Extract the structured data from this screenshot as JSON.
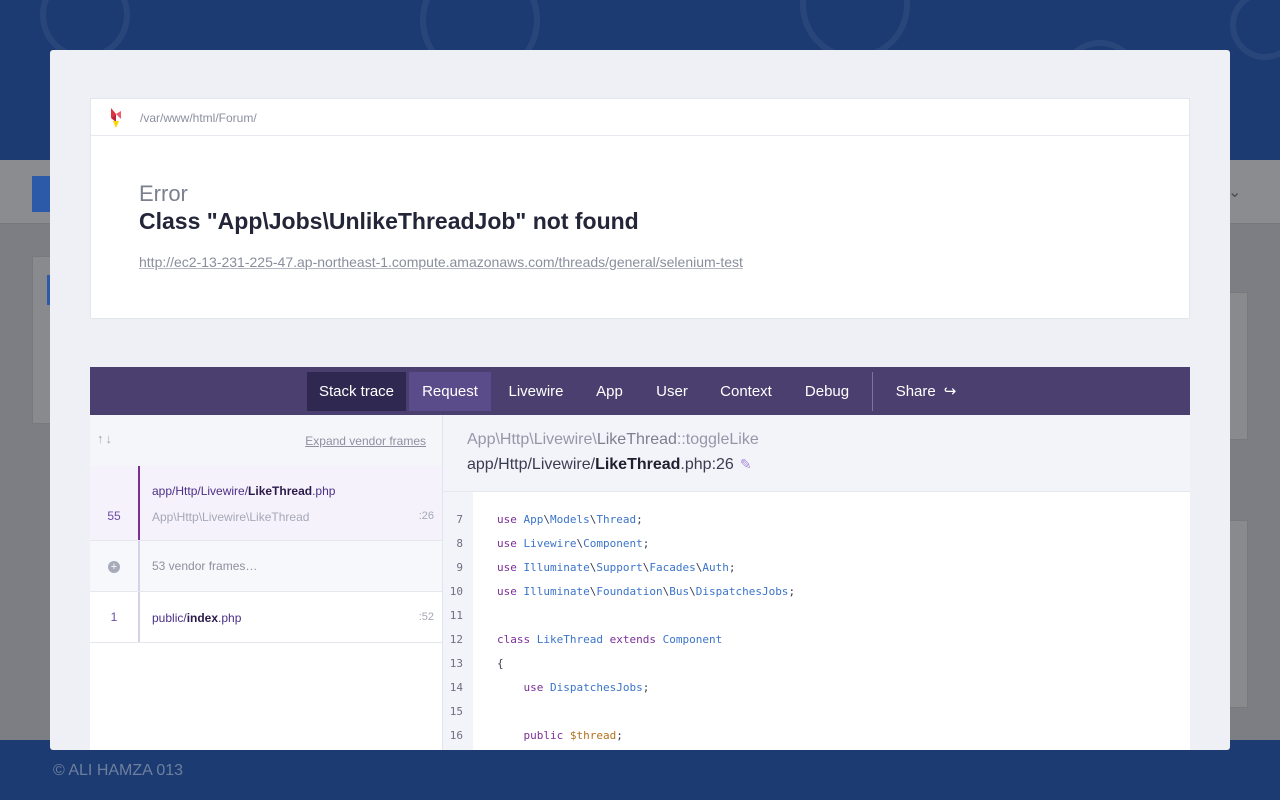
{
  "background": {
    "footer_copyright": "© ALI HAMZA 013"
  },
  "header": {
    "path": "/var/www/html/Forum/",
    "error_label": "Error",
    "error_message": "Class \"App\\Jobs\\UnlikeThreadJob\" not found",
    "url": "http://ec2-13-231-225-47.ap-northeast-1.compute.amazonaws.com/threads/general/selenium-test"
  },
  "tabs": [
    {
      "label": "Stack trace"
    },
    {
      "label": "Request"
    },
    {
      "label": "Livewire"
    },
    {
      "label": "App"
    },
    {
      "label": "User"
    },
    {
      "label": "Context"
    },
    {
      "label": "Debug"
    },
    {
      "label": "Share"
    }
  ],
  "frames": {
    "expand_label": "Expand vendor frames",
    "items": [
      {
        "number": "55",
        "file_prefix": "app/Http/Livewire/",
        "file_name": "LikeThread",
        "file_ext": ".php",
        "class": "App\\Http\\Livewire\\LikeThread",
        "line": ":26"
      },
      {
        "vendor_text": "53 vendor frames…"
      },
      {
        "number": "1",
        "file_prefix": "public/",
        "file_name": "index",
        "file_ext": ".php",
        "line": ":52"
      }
    ]
  },
  "code": {
    "method_prefix": "App\\Http\\Livewire\\",
    "method_class": "LikeThread",
    "method_name": "::toggleLike",
    "file_prefix": "app/Http/Livewire/",
    "file_name": "LikeThread",
    "file_suffix": ".php:26",
    "lines": [
      {
        "n": "7"
      },
      {
        "n": "8"
      },
      {
        "n": "9"
      },
      {
        "n": "10"
      },
      {
        "n": "11"
      },
      {
        "n": "12"
      },
      {
        "n": "13"
      },
      {
        "n": "14"
      },
      {
        "n": "15"
      },
      {
        "n": "16"
      }
    ]
  },
  "colors": {
    "tabbar": "#4a3f6e",
    "accent": "#7b2e93",
    "background_blue": "#1c3b72"
  }
}
